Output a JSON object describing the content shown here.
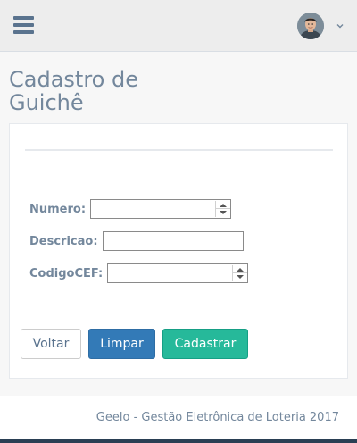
{
  "topbar": {
    "menu_icon": "hamburger-icon",
    "user_avatar_icon": "user-avatar",
    "user_menu_icon": "chevron-down-icon"
  },
  "page": {
    "title": "Cadastro de Guichê"
  },
  "form": {
    "numero": {
      "label": "Numero:",
      "value": ""
    },
    "descricao": {
      "label": "Descricao:",
      "value": ""
    },
    "codigocef": {
      "label": "CodigoCEF:",
      "value": ""
    }
  },
  "buttons": {
    "voltar": "Voltar",
    "limpar": "Limpar",
    "cadastrar": "Cadastrar"
  },
  "footer": {
    "text": "Geelo - Gestão Eletrônica de Loteria 2017"
  },
  "colors": {
    "primary": "#337ab7",
    "success": "#26b99a",
    "nav_dark": "#2a3f54",
    "text": "#73879c"
  }
}
